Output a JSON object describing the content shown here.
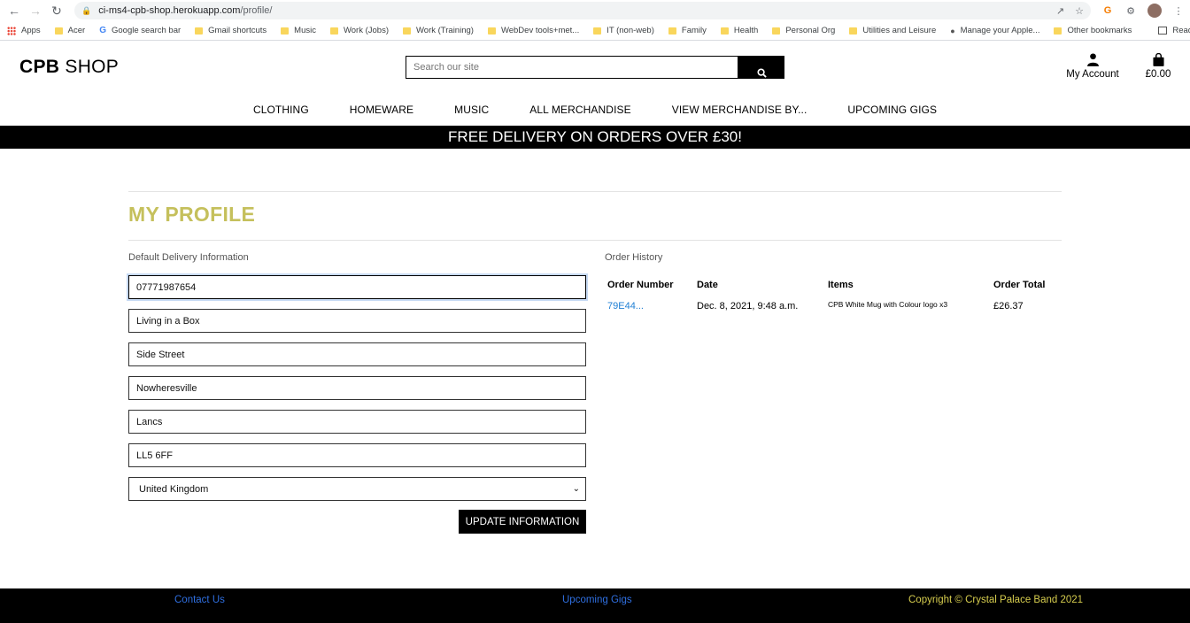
{
  "browser": {
    "url_host": "ci-ms4-cpb-shop.herokuapp.com",
    "url_path": "/profile/",
    "bookmarks": [
      "Apps",
      "Acer",
      "Google search bar",
      "Gmail shortcuts",
      "Music",
      "Work (Jobs)",
      "Work (Training)",
      "WebDev tools+met...",
      "IT (non-web)",
      "Family",
      "Health",
      "Personal Org",
      "Utilities and Leisure",
      "Manage your Apple..."
    ],
    "other_bookmarks": "Other bookmarks",
    "reading_list": "Reading list"
  },
  "header": {
    "logo_bold": "CPB",
    "logo_light": "SHOP",
    "search_placeholder": "Search our site",
    "account_label": "My Account",
    "bag_total": "£0.00"
  },
  "nav": [
    "CLOTHING",
    "HOMEWARE",
    "MUSIC",
    "ALL MERCHANDISE",
    "VIEW MERCHANDISE BY...",
    "UPCOMING GIGS"
  ],
  "banner": "FREE DELIVERY ON ORDERS OVER £30!",
  "profile": {
    "title": "MY PROFILE",
    "delivery_label": "Default Delivery Information",
    "fields": {
      "phone": "07771987654",
      "address1": "Living in a Box",
      "address2": "Side Street",
      "town": "Nowheresville",
      "county": "Lancs",
      "postcode": "LL5 6FF",
      "country": "United Kingdom"
    },
    "update_button": "UPDATE INFORMATION"
  },
  "order_history": {
    "label": "Order History",
    "columns": [
      "Order Number",
      "Date",
      "Items",
      "Order Total"
    ],
    "rows": [
      {
        "number": "79E44...",
        "date": "Dec. 8, 2021, 9:48 a.m.",
        "items": "CPB White Mug with Colour logo x3",
        "total": "£26.37"
      }
    ]
  },
  "footer": {
    "contact": "Contact Us",
    "gigs": "Upcoming Gigs",
    "copyright": "Copyright © Crystal Palace Band 2021"
  },
  "colors": {
    "title": "#c5c05c",
    "link": "#1f7fd4",
    "copyright": "#d6cd4e"
  }
}
